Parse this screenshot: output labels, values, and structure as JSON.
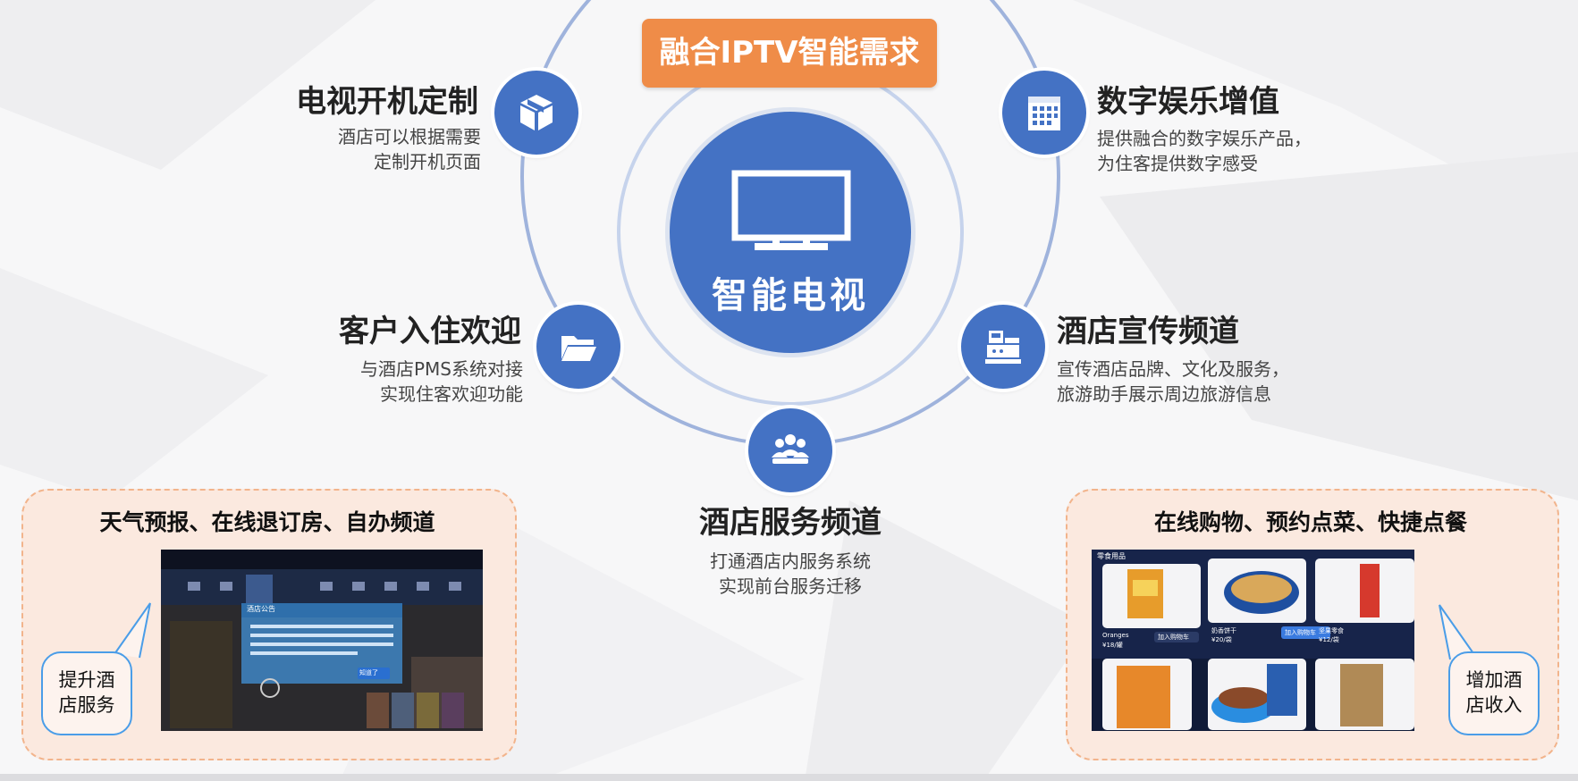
{
  "title": "融合IPTV智能需求",
  "center": {
    "label": "智能电视",
    "icon": "tv-icon"
  },
  "features": [
    {
      "title": "电视开机定制",
      "desc1": "酒店可以根据需要",
      "desc2": "定制开机页面",
      "icon": "box-icon"
    },
    {
      "title": "数字娱乐增值",
      "desc1": "提供融合的数字娱乐产品，",
      "desc2": "为住客提供数字感受",
      "icon": "calendar-icon"
    },
    {
      "title": "客户入住欢迎",
      "desc1": "与酒店PMS系统对接",
      "desc2": "实现住客欢迎功能",
      "icon": "folder-icon"
    },
    {
      "title": "酒店宣传频道",
      "desc1": "宣传酒店品牌、文化及服务，",
      "desc2": "旅游助手展示周边旅游信息",
      "icon": "cash-register-icon"
    },
    {
      "title": "酒店服务频道",
      "desc1": "打通酒店内服务系统",
      "desc2": "实现前台服务迁移",
      "icon": "people-icon"
    }
  ],
  "panels": {
    "left": {
      "title": "天气预报、在线退订房、自办频道",
      "bubble1": "提升酒",
      "bubble2": "店服务",
      "screen": {
        "popup_title": "酒店公告",
        "button": "知道了"
      }
    },
    "right": {
      "title": "在线购物、预约点菜、快捷点餐",
      "bubble1": "增加酒",
      "bubble2": "店收入",
      "screen": {
        "header": "零食用品",
        "items": [
          {
            "name": "Oranges",
            "price": "¥18/罐",
            "button": "加入购物车"
          },
          {
            "name": "奶香饼干",
            "price": "¥20/袋",
            "button": "加入购物车"
          },
          {
            "name": "坚果零食",
            "price": "¥12/袋",
            "button": ""
          }
        ]
      }
    }
  },
  "colors": {
    "accent": "#4472c4",
    "badge": "#ef8c48",
    "panel": "#fbe9df",
    "bubble_border": "#4a9de8"
  }
}
